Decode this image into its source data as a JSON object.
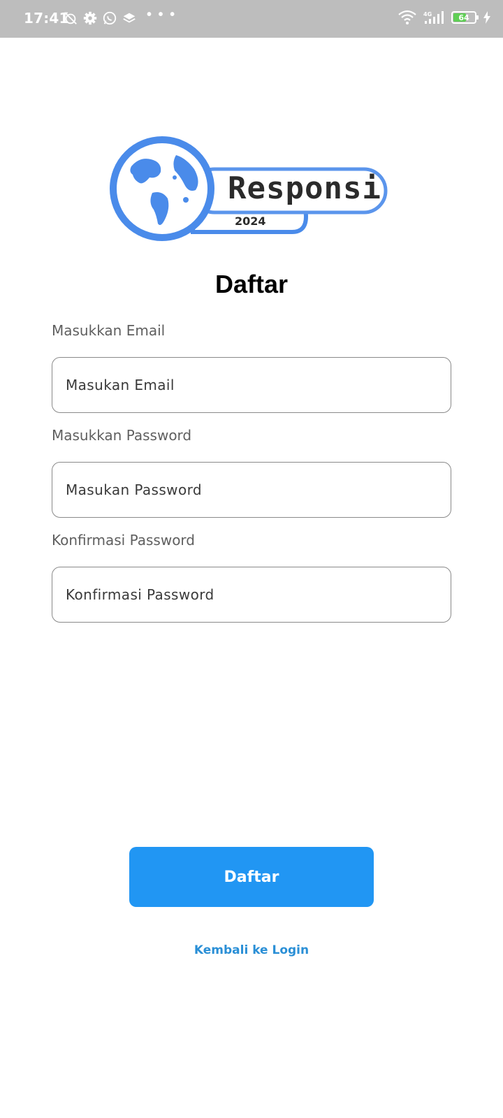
{
  "status_bar": {
    "time": "17:41",
    "more_indicator": "• • •",
    "network_type": "4G",
    "battery_level": "64",
    "battery_fraction": 0.64,
    "left_icons": [
      "alarm-off-icon",
      "gear-icon",
      "whatsapp-icon",
      "layers-icon"
    ],
    "right_icons": [
      "wifi-icon",
      "signal-icon",
      "battery-icon",
      "charging-icon"
    ]
  },
  "logo": {
    "brand_text": "Responsi",
    "year_text": "2024",
    "accent_color": "#4a8bea"
  },
  "page": {
    "title": "Daftar"
  },
  "form": {
    "email": {
      "label": "Masukkan Email",
      "placeholder": "Masukan Email",
      "value": ""
    },
    "password": {
      "label": "Masukkan Password",
      "placeholder": "Masukan Password",
      "value": ""
    },
    "confirm_password": {
      "label": "Konfirmasi Password",
      "placeholder": "Konfirmasi Password",
      "value": ""
    }
  },
  "actions": {
    "submit_label": "Daftar",
    "back_link_label": "Kembali ke Login",
    "primary_color": "#2196f3",
    "link_color": "#2a8fd6"
  }
}
